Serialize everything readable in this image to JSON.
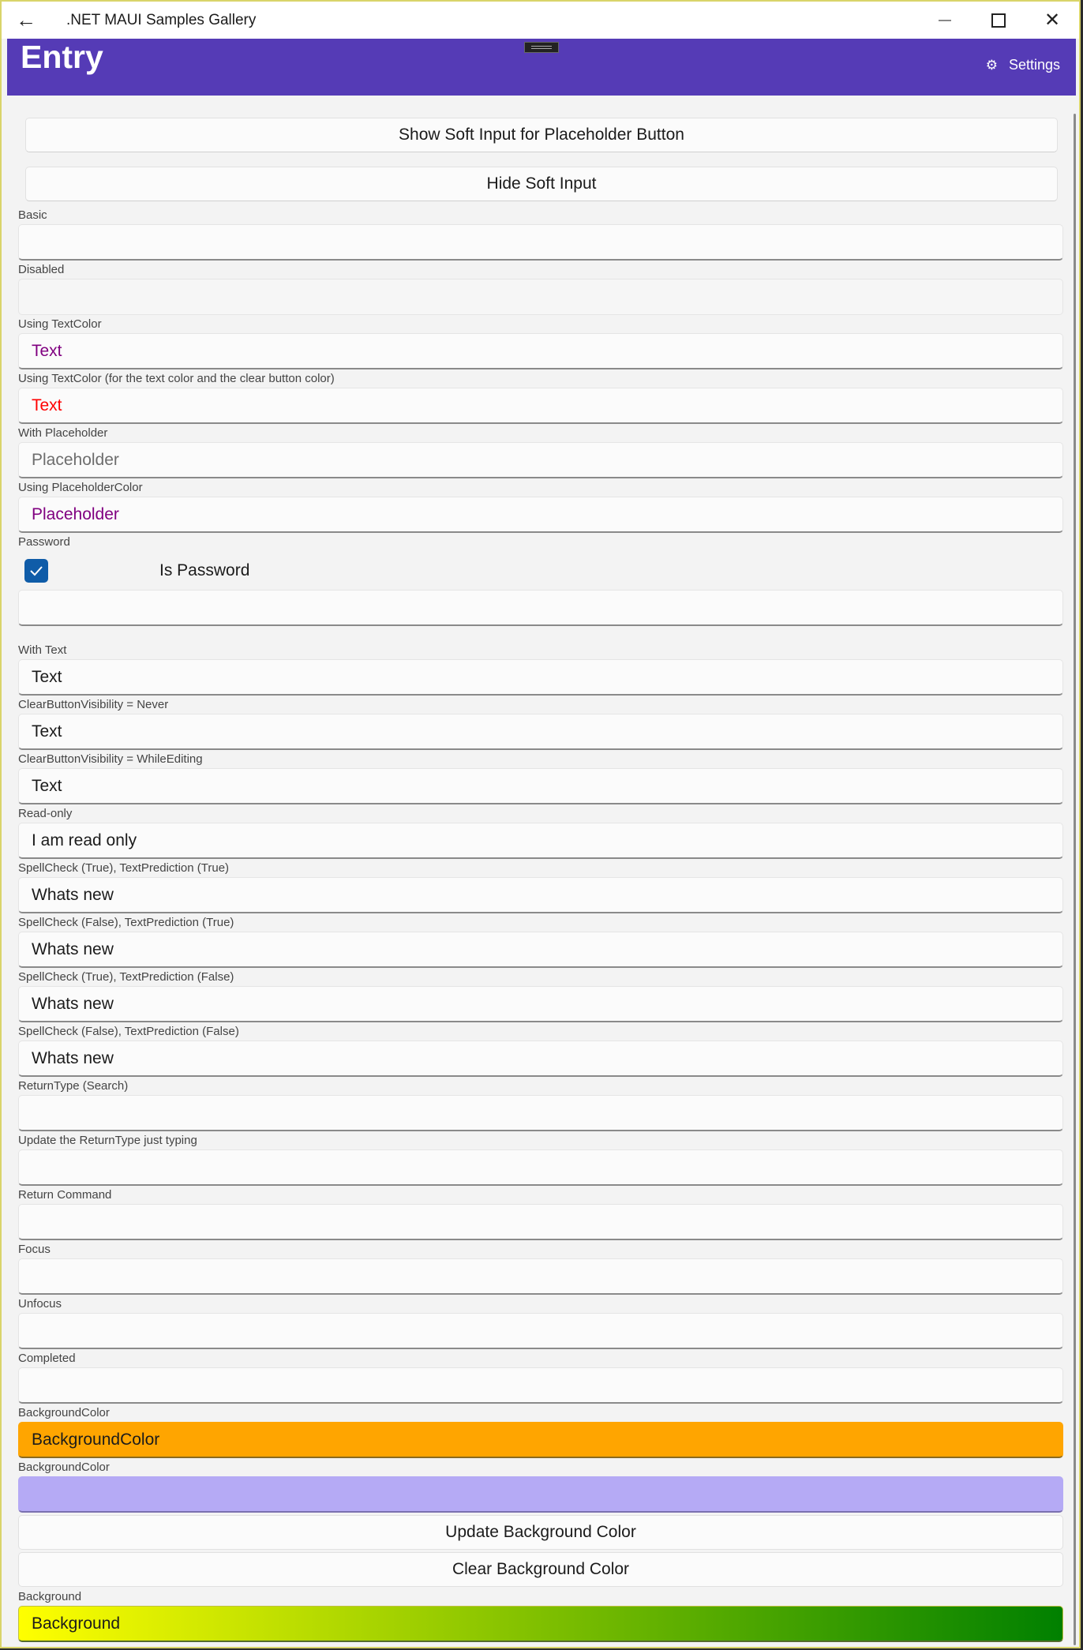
{
  "titlebar": {
    "app_title": ".NET MAUI Samples Gallery",
    "back_glyph": "←",
    "minimize_glyph": "—",
    "close_glyph": "✕"
  },
  "header": {
    "page_title": "Entry",
    "settings_label": "Settings",
    "gear_glyph": "⚙",
    "background": "#553bb6"
  },
  "buttons": {
    "show_soft_input": "Show Soft Input for Placeholder Button",
    "hide_soft_input": "Hide Soft Input",
    "update_background": "Update Background Color",
    "clear_background": "Clear Background Color"
  },
  "sections": [
    {
      "label": "Basic",
      "value": ""
    },
    {
      "label": "Disabled",
      "value": ""
    },
    {
      "label": "Using TextColor",
      "value": "Text",
      "color": "#800080"
    },
    {
      "label": "Using TextColor (for the text color and the clear button color)",
      "value": "Text",
      "color": "#ff0000"
    },
    {
      "label": "With Placeholder",
      "placeholder": "Placeholder"
    },
    {
      "label": "Using PlaceholderColor",
      "placeholder": "Placeholder",
      "color": "#800080"
    },
    {
      "label": "Password",
      "checkbox_label": "Is Password",
      "checked": true,
      "value": ""
    },
    {
      "label": "With Text",
      "value": "Text"
    },
    {
      "label": "ClearButtonVisibility = Never",
      "value": "Text"
    },
    {
      "label": "ClearButtonVisibility = WhileEditing",
      "value": "Text"
    },
    {
      "label": "Read-only",
      "value": "I am read only"
    },
    {
      "label": "SpellCheck (True), TextPrediction (True)",
      "value": "Whats new"
    },
    {
      "label": "SpellCheck (False), TextPrediction (True)",
      "value": "Whats new"
    },
    {
      "label": "SpellCheck (True), TextPrediction (False)",
      "value": "Whats new"
    },
    {
      "label": "SpellCheck (False), TextPrediction (False)",
      "value": "Whats new"
    },
    {
      "label": "ReturnType (Search)",
      "value": ""
    },
    {
      "label": "Update the ReturnType just typing",
      "value": ""
    },
    {
      "label": "Return Command",
      "value": ""
    },
    {
      "label": "Focus",
      "value": ""
    },
    {
      "label": "Unfocus",
      "value": ""
    },
    {
      "label": "Completed",
      "value": ""
    },
    {
      "label": "BackgroundColor",
      "value": "BackgroundColor",
      "background": "#ffa500"
    },
    {
      "label": "BackgroundColor",
      "value": "",
      "background": "#b5aaf5"
    },
    {
      "label": "Background",
      "value": "Background",
      "gradient": [
        "#ffff00",
        "#008000"
      ]
    }
  ]
}
